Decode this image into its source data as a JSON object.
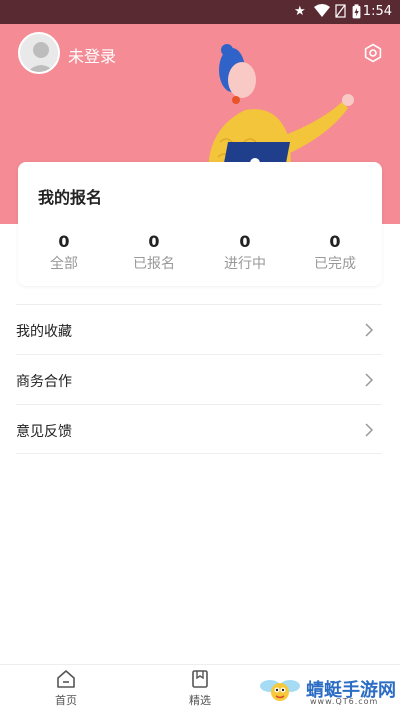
{
  "status_bar": {
    "time": "1:54"
  },
  "profile": {
    "login_status": "未登录"
  },
  "signup_card": {
    "title": "我的报名",
    "stats": [
      {
        "value": "0",
        "label": "全部"
      },
      {
        "value": "0",
        "label": "已报名"
      },
      {
        "value": "0",
        "label": "进行中"
      },
      {
        "value": "0",
        "label": "已完成"
      }
    ]
  },
  "menu": [
    {
      "label": "我的收藏"
    },
    {
      "label": "商务合作"
    },
    {
      "label": "意见反馈"
    }
  ],
  "tabbar": [
    {
      "label": "首页",
      "icon": "home-icon"
    },
    {
      "label": "精选",
      "icon": "bookmark-icon"
    }
  ],
  "watermark": {
    "text": "蜻蜓手游网",
    "sub": "www.QT6.com"
  },
  "colors": {
    "header": "#f48b95",
    "status_bar": "#5a2a32",
    "accent_text": "#222222"
  }
}
